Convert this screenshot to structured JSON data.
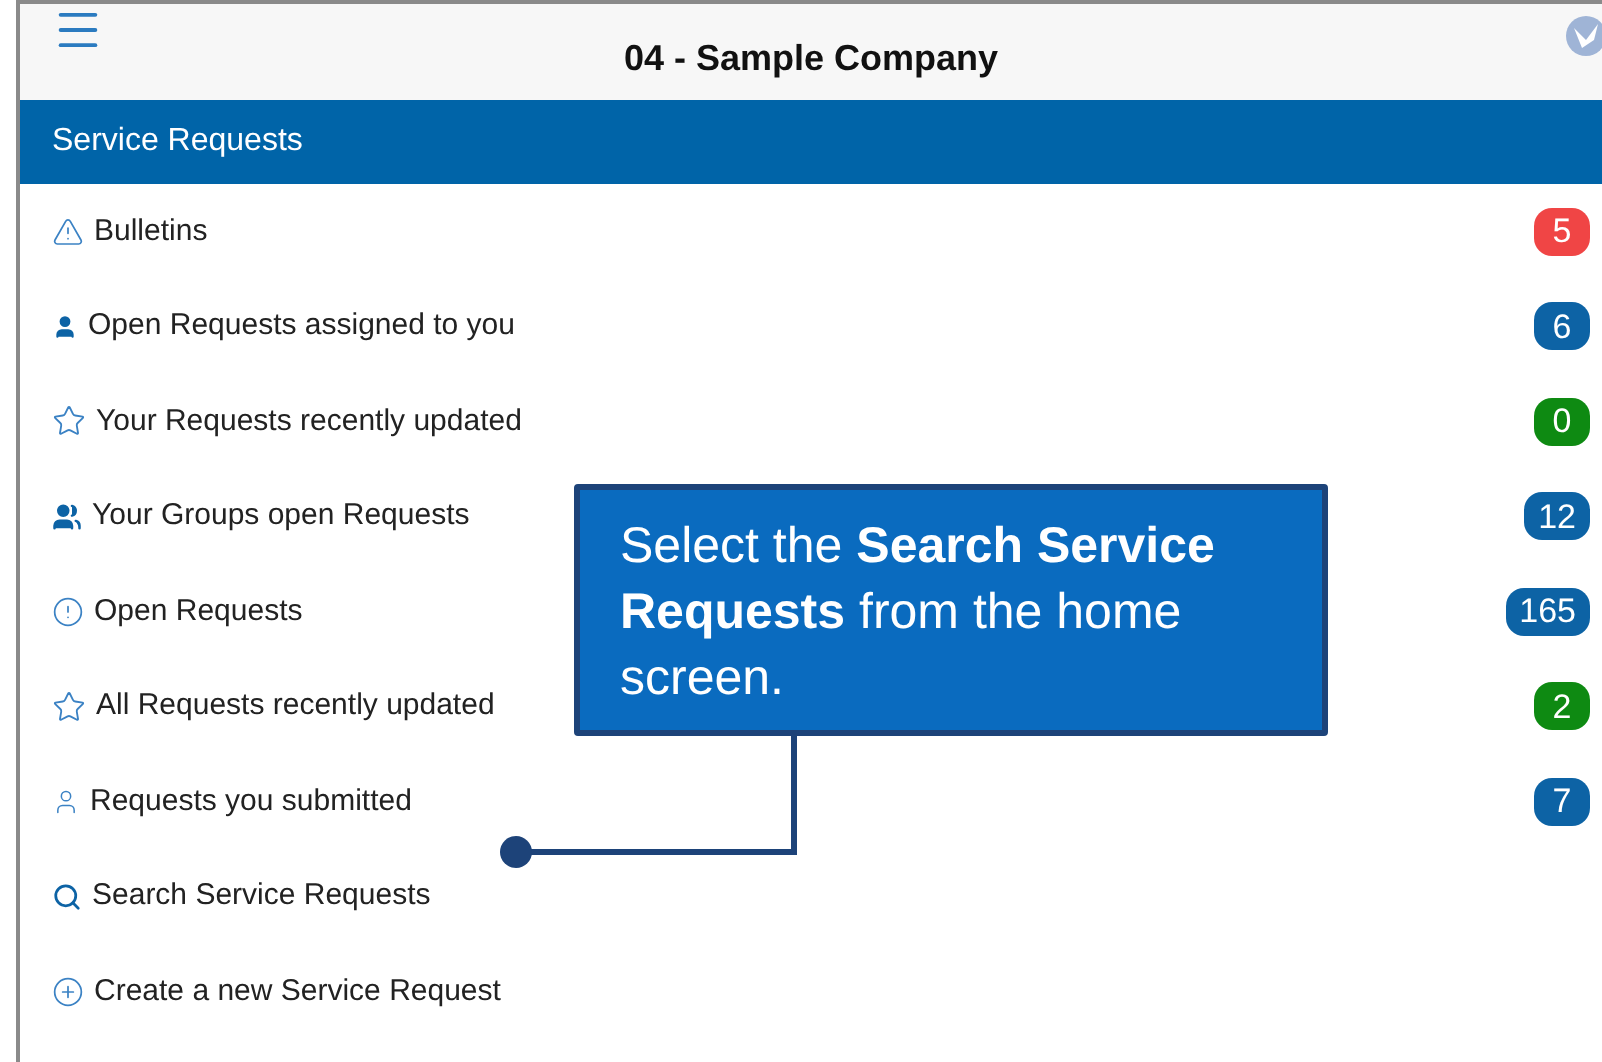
{
  "header": {
    "title": "04 - Sample Company"
  },
  "section": {
    "title": "Service Requests"
  },
  "items": [
    {
      "kind": "warning",
      "label": "Bulletins",
      "badge": "5",
      "color": "#f04545"
    },
    {
      "kind": "user",
      "label": "Open Requests assigned to you",
      "badge": "6",
      "color": "#0d63a5"
    },
    {
      "kind": "star",
      "label": "Your Requests recently updated",
      "badge": "0",
      "color": "#0e8a12"
    },
    {
      "kind": "group",
      "label": "Your Groups open Requests",
      "badge": "12",
      "color": "#0d63a5"
    },
    {
      "kind": "alert",
      "label": "Open Requests",
      "badge": "165",
      "color": "#0d63a5"
    },
    {
      "kind": "star",
      "label": "All Requests recently updated",
      "badge": "2",
      "color": "#0e8a12"
    },
    {
      "kind": "submitter",
      "label": "Requests you submitted",
      "badge": "7",
      "color": "#0d63a5"
    },
    {
      "kind": "search",
      "label": "Search Service Requests"
    },
    {
      "kind": "create",
      "label": "Create a new Service Request"
    }
  ],
  "callout": {
    "text": "Select the **Search Service Requests** from the home screen."
  }
}
